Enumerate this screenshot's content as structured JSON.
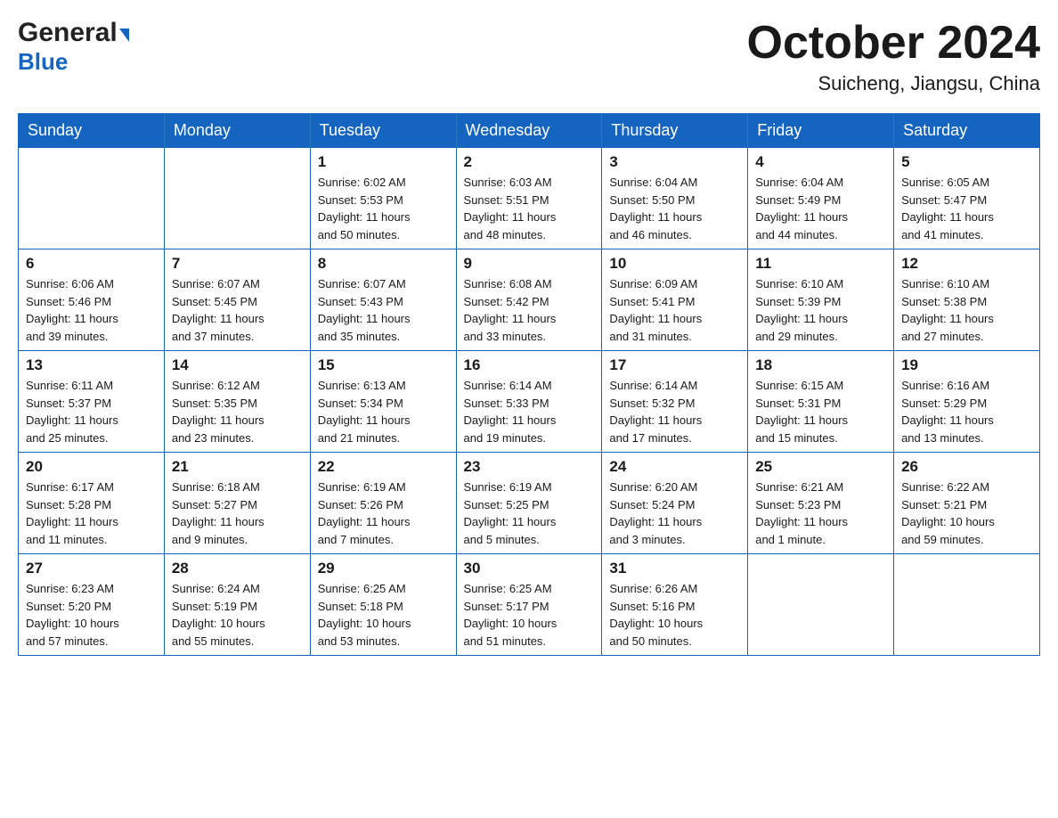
{
  "header": {
    "logo_general": "General",
    "logo_blue": "Blue",
    "title": "October 2024",
    "subtitle": "Suicheng, Jiangsu, China"
  },
  "weekdays": [
    "Sunday",
    "Monday",
    "Tuesday",
    "Wednesday",
    "Thursday",
    "Friday",
    "Saturday"
  ],
  "weeks": [
    [
      {
        "day": "",
        "info": ""
      },
      {
        "day": "",
        "info": ""
      },
      {
        "day": "1",
        "info": "Sunrise: 6:02 AM\nSunset: 5:53 PM\nDaylight: 11 hours\nand 50 minutes."
      },
      {
        "day": "2",
        "info": "Sunrise: 6:03 AM\nSunset: 5:51 PM\nDaylight: 11 hours\nand 48 minutes."
      },
      {
        "day": "3",
        "info": "Sunrise: 6:04 AM\nSunset: 5:50 PM\nDaylight: 11 hours\nand 46 minutes."
      },
      {
        "day": "4",
        "info": "Sunrise: 6:04 AM\nSunset: 5:49 PM\nDaylight: 11 hours\nand 44 minutes."
      },
      {
        "day": "5",
        "info": "Sunrise: 6:05 AM\nSunset: 5:47 PM\nDaylight: 11 hours\nand 41 minutes."
      }
    ],
    [
      {
        "day": "6",
        "info": "Sunrise: 6:06 AM\nSunset: 5:46 PM\nDaylight: 11 hours\nand 39 minutes."
      },
      {
        "day": "7",
        "info": "Sunrise: 6:07 AM\nSunset: 5:45 PM\nDaylight: 11 hours\nand 37 minutes."
      },
      {
        "day": "8",
        "info": "Sunrise: 6:07 AM\nSunset: 5:43 PM\nDaylight: 11 hours\nand 35 minutes."
      },
      {
        "day": "9",
        "info": "Sunrise: 6:08 AM\nSunset: 5:42 PM\nDaylight: 11 hours\nand 33 minutes."
      },
      {
        "day": "10",
        "info": "Sunrise: 6:09 AM\nSunset: 5:41 PM\nDaylight: 11 hours\nand 31 minutes."
      },
      {
        "day": "11",
        "info": "Sunrise: 6:10 AM\nSunset: 5:39 PM\nDaylight: 11 hours\nand 29 minutes."
      },
      {
        "day": "12",
        "info": "Sunrise: 6:10 AM\nSunset: 5:38 PM\nDaylight: 11 hours\nand 27 minutes."
      }
    ],
    [
      {
        "day": "13",
        "info": "Sunrise: 6:11 AM\nSunset: 5:37 PM\nDaylight: 11 hours\nand 25 minutes."
      },
      {
        "day": "14",
        "info": "Sunrise: 6:12 AM\nSunset: 5:35 PM\nDaylight: 11 hours\nand 23 minutes."
      },
      {
        "day": "15",
        "info": "Sunrise: 6:13 AM\nSunset: 5:34 PM\nDaylight: 11 hours\nand 21 minutes."
      },
      {
        "day": "16",
        "info": "Sunrise: 6:14 AM\nSunset: 5:33 PM\nDaylight: 11 hours\nand 19 minutes."
      },
      {
        "day": "17",
        "info": "Sunrise: 6:14 AM\nSunset: 5:32 PM\nDaylight: 11 hours\nand 17 minutes."
      },
      {
        "day": "18",
        "info": "Sunrise: 6:15 AM\nSunset: 5:31 PM\nDaylight: 11 hours\nand 15 minutes."
      },
      {
        "day": "19",
        "info": "Sunrise: 6:16 AM\nSunset: 5:29 PM\nDaylight: 11 hours\nand 13 minutes."
      }
    ],
    [
      {
        "day": "20",
        "info": "Sunrise: 6:17 AM\nSunset: 5:28 PM\nDaylight: 11 hours\nand 11 minutes."
      },
      {
        "day": "21",
        "info": "Sunrise: 6:18 AM\nSunset: 5:27 PM\nDaylight: 11 hours\nand 9 minutes."
      },
      {
        "day": "22",
        "info": "Sunrise: 6:19 AM\nSunset: 5:26 PM\nDaylight: 11 hours\nand 7 minutes."
      },
      {
        "day": "23",
        "info": "Sunrise: 6:19 AM\nSunset: 5:25 PM\nDaylight: 11 hours\nand 5 minutes."
      },
      {
        "day": "24",
        "info": "Sunrise: 6:20 AM\nSunset: 5:24 PM\nDaylight: 11 hours\nand 3 minutes."
      },
      {
        "day": "25",
        "info": "Sunrise: 6:21 AM\nSunset: 5:23 PM\nDaylight: 11 hours\nand 1 minute."
      },
      {
        "day": "26",
        "info": "Sunrise: 6:22 AM\nSunset: 5:21 PM\nDaylight: 10 hours\nand 59 minutes."
      }
    ],
    [
      {
        "day": "27",
        "info": "Sunrise: 6:23 AM\nSunset: 5:20 PM\nDaylight: 10 hours\nand 57 minutes."
      },
      {
        "day": "28",
        "info": "Sunrise: 6:24 AM\nSunset: 5:19 PM\nDaylight: 10 hours\nand 55 minutes."
      },
      {
        "day": "29",
        "info": "Sunrise: 6:25 AM\nSunset: 5:18 PM\nDaylight: 10 hours\nand 53 minutes."
      },
      {
        "day": "30",
        "info": "Sunrise: 6:25 AM\nSunset: 5:17 PM\nDaylight: 10 hours\nand 51 minutes."
      },
      {
        "day": "31",
        "info": "Sunrise: 6:26 AM\nSunset: 5:16 PM\nDaylight: 10 hours\nand 50 minutes."
      },
      {
        "day": "",
        "info": ""
      },
      {
        "day": "",
        "info": ""
      }
    ]
  ]
}
